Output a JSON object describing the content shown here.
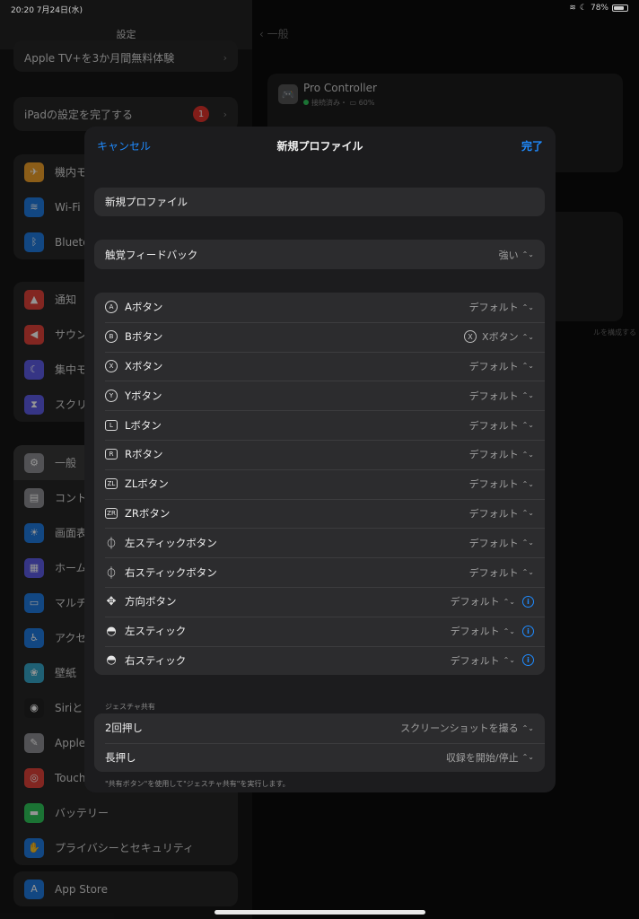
{
  "status": {
    "time": "20:20  7月24日(水)",
    "battery": "78%"
  },
  "sidebar": {
    "title": "設定",
    "promo": "Apple TV+を3か月間無料体験",
    "setup": {
      "label": "iPadの設定を完了する",
      "badge": "1"
    },
    "group1": [
      {
        "label": "機内モ",
        "icon": "airplane-icon",
        "color": "#f0a02a",
        "glyph": "✈"
      },
      {
        "label": "Wi-Fi",
        "icon": "wifi-icon",
        "color": "#1f7ae0",
        "glyph": "≋"
      },
      {
        "label": "Blueto",
        "icon": "bluetooth-icon",
        "color": "#1f7ae0",
        "glyph": "ᛒ"
      }
    ],
    "group2": [
      {
        "label": "通知",
        "icon": "bell-icon",
        "color": "#e0433a",
        "glyph": "▲"
      },
      {
        "label": "サウン",
        "icon": "speaker-icon",
        "color": "#e0433a",
        "glyph": "◀"
      },
      {
        "label": "集中モ",
        "icon": "moon-icon",
        "color": "#5e5ce6",
        "glyph": "☾"
      },
      {
        "label": "スクリ",
        "icon": "hourglass-icon",
        "color": "#5e5ce6",
        "glyph": "⧗"
      }
    ],
    "group3": [
      {
        "label": "一般",
        "icon": "gear-icon",
        "color": "#8e8e93",
        "glyph": "⚙",
        "active": true
      },
      {
        "label": "コント",
        "icon": "toggles-icon",
        "color": "#8e8e93",
        "glyph": "▤"
      },
      {
        "label": "画面表",
        "icon": "brightness-icon",
        "color": "#1f7ae0",
        "glyph": "☀"
      },
      {
        "label": "ホーム",
        "icon": "apps-grid-icon",
        "color": "#5e5ce6",
        "glyph": "▦"
      },
      {
        "label": "マルチ",
        "icon": "multitask-icon",
        "color": "#1f7ae0",
        "glyph": "▭"
      },
      {
        "label": "アクセ",
        "icon": "accessibility-icon",
        "color": "#1f7ae0",
        "glyph": "♿"
      },
      {
        "label": "壁紙",
        "icon": "wallpaper-icon",
        "color": "#36a6c9",
        "glyph": "❀"
      },
      {
        "label": "Siriと",
        "icon": "siri-icon",
        "color": "#222",
        "glyph": "◉"
      },
      {
        "label": "Apple",
        "icon": "pencil-icon",
        "color": "#8e8e93",
        "glyph": "✎"
      },
      {
        "label": "Touch",
        "icon": "fingerprint-icon",
        "color": "#e0433a",
        "glyph": "◎"
      },
      {
        "label": "バッテリー",
        "icon": "battery-icon",
        "color": "#30c75a",
        "glyph": "▬"
      },
      {
        "label": "プライバシーとセキュリティ",
        "icon": "hand-icon",
        "color": "#1f7ae0",
        "glyph": "✋"
      }
    ],
    "group4": [
      {
        "label": "App Store",
        "icon": "appstore-icon",
        "color": "#1f7ae0",
        "glyph": "A"
      }
    ]
  },
  "detail": {
    "back": "一般",
    "controller": {
      "name": "Pro Controller",
      "status": "接続済み・",
      "battery": "60%"
    },
    "footnote": "ルを構成する"
  },
  "modal": {
    "cancel": "キャンセル",
    "title": "新規プロファイル",
    "done": "完了",
    "name_field": "新規プロファイル",
    "haptic": {
      "label": "触覚フィードバック",
      "value": "強い"
    },
    "buttons": [
      {
        "glyph": "A",
        "shape": "circle",
        "label": "Aボタン",
        "value": "デフォルト",
        "name": "a"
      },
      {
        "glyph": "B",
        "shape": "circle",
        "label": "Bボタン",
        "value": "Xボタン",
        "remap": "X",
        "name": "b"
      },
      {
        "glyph": "X",
        "shape": "circle",
        "label": "Xボタン",
        "value": "デフォルト",
        "name": "x"
      },
      {
        "glyph": "Y",
        "shape": "circle",
        "label": "Yボタン",
        "value": "デフォルト",
        "name": "y"
      },
      {
        "glyph": "L",
        "shape": "square",
        "label": "Lボタン",
        "value": "デフォルト",
        "name": "l"
      },
      {
        "glyph": "R",
        "shape": "square",
        "label": "Rボタン",
        "value": "デフォルト",
        "name": "r"
      },
      {
        "glyph": "ZL",
        "shape": "square",
        "label": "ZLボタン",
        "value": "デフォルト",
        "name": "zl"
      },
      {
        "glyph": "ZR",
        "shape": "square",
        "label": "ZRボタン",
        "value": "デフォルト",
        "name": "zr"
      },
      {
        "glyph": "⏀",
        "shape": "sym",
        "label": "左スティックボタン",
        "value": "デフォルト",
        "name": "left-stick-button"
      },
      {
        "glyph": "⏀",
        "shape": "sym",
        "label": "右スティックボタン",
        "value": "デフォルト",
        "name": "right-stick-button"
      },
      {
        "glyph": "✥",
        "shape": "sym",
        "label": "方向ボタン",
        "value": "デフォルト",
        "info": true,
        "name": "dpad"
      },
      {
        "glyph": "◓",
        "shape": "sym",
        "label": "左スティック",
        "value": "デフォルト",
        "info": true,
        "name": "left-stick"
      },
      {
        "glyph": "◓",
        "shape": "sym",
        "label": "右スティック",
        "value": "デフォルト",
        "info": true,
        "name": "right-stick"
      }
    ],
    "gesture_section": "ジェスチャ共有",
    "gestures": [
      {
        "label": "2回押し",
        "value": "スクリーンショットを撮る",
        "name": "double-press"
      },
      {
        "label": "長押し",
        "value": "収録を開始/停止",
        "name": "long-press"
      }
    ],
    "gesture_footer": "\"共有ボタン\"を使用して\"ジェスチャ共有\"を実行します。"
  }
}
